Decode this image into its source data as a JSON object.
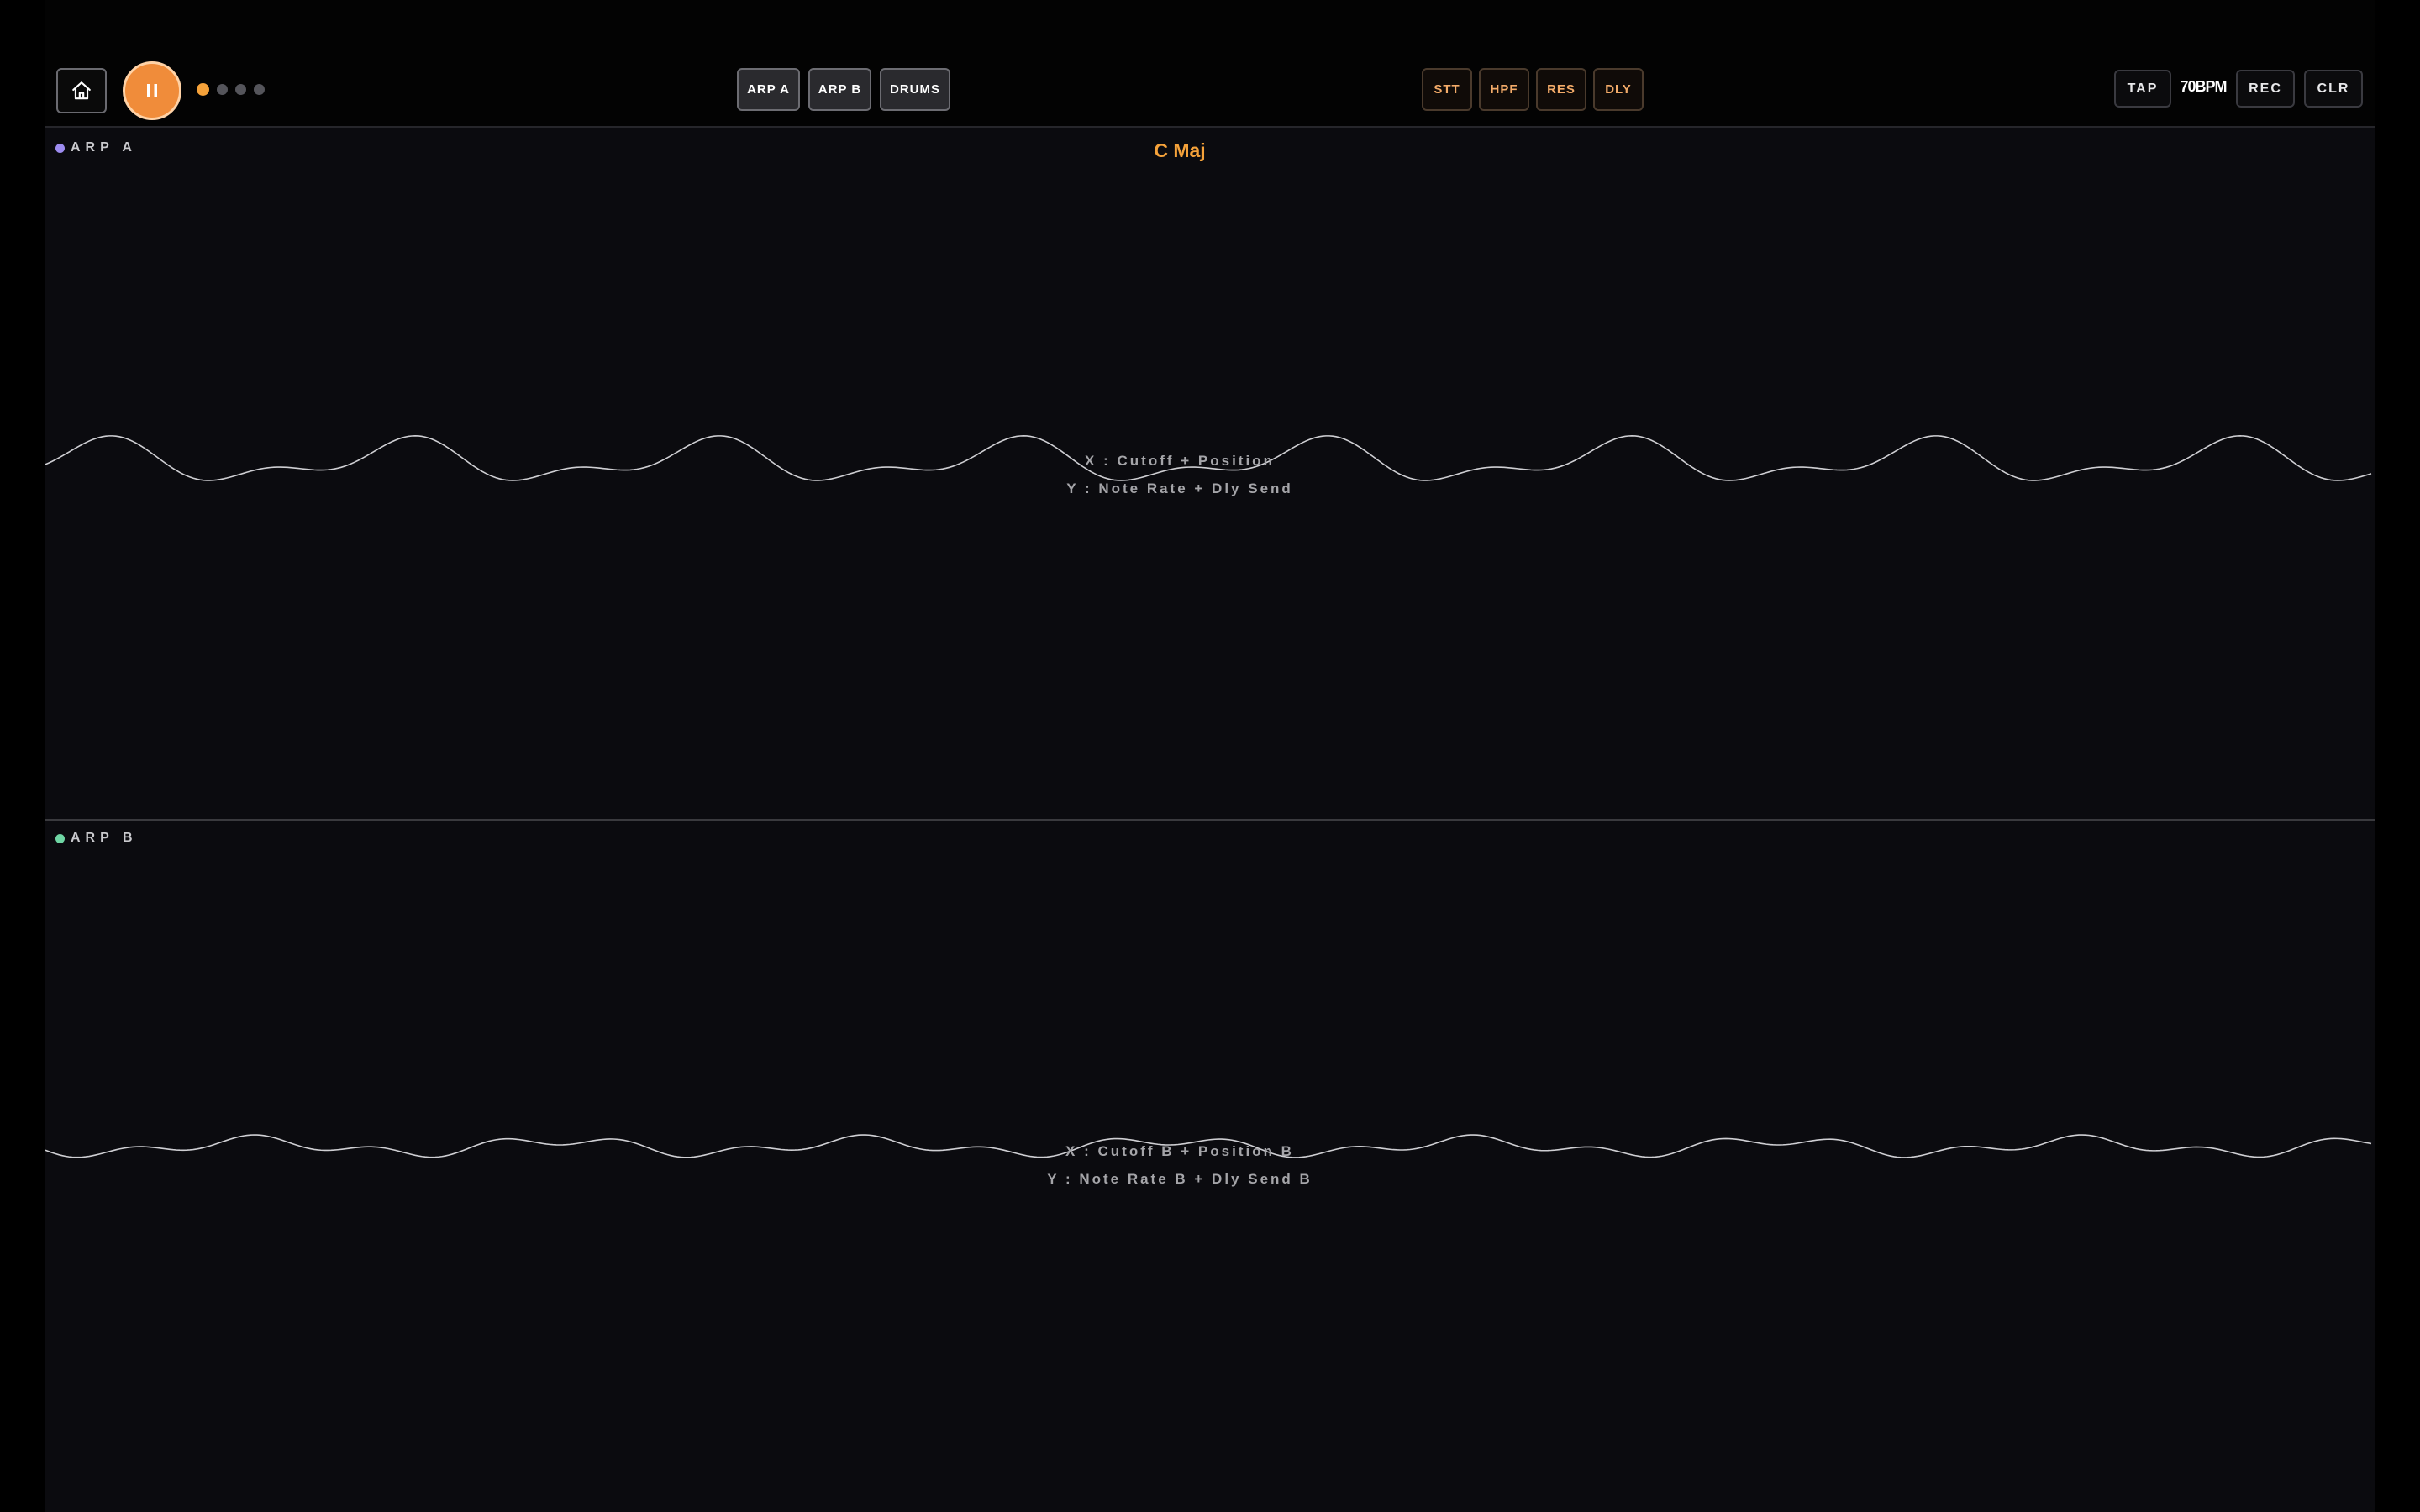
{
  "topbar": {
    "home_icon": "home-icon",
    "play_icon": "pause-icon",
    "page_dots": [
      {
        "active": true
      },
      {
        "active": false
      },
      {
        "active": false
      },
      {
        "active": false
      }
    ],
    "tracks": [
      {
        "label": "ARP A"
      },
      {
        "label": "ARP B"
      },
      {
        "label": "DRUMS"
      }
    ],
    "effects": [
      {
        "label": "STT"
      },
      {
        "label": "HPF"
      },
      {
        "label": "RES"
      },
      {
        "label": "DLY"
      }
    ],
    "tap_label": "TAP",
    "bpm": "70BPM",
    "rec_label": "REC",
    "clr_label": "CLR"
  },
  "panel_a": {
    "label": "ARP A",
    "dot_color": "#9d8cf0",
    "scale": "C Maj",
    "x_label": "X : Cutoff + Position",
    "y_label": "Y : Note Rate + Dly Send"
  },
  "panel_b": {
    "label": "ARP B",
    "dot_color": "#6fd6a4",
    "x_label": "X : Cutoff B + Position B",
    "y_label": "Y : Note Rate B + Dly Send B"
  },
  "colors": {
    "accent": "#f08c3a",
    "accent_text": "#f5a23a",
    "fx_text": "#f3ab69",
    "wave": "#cfcfd3"
  }
}
